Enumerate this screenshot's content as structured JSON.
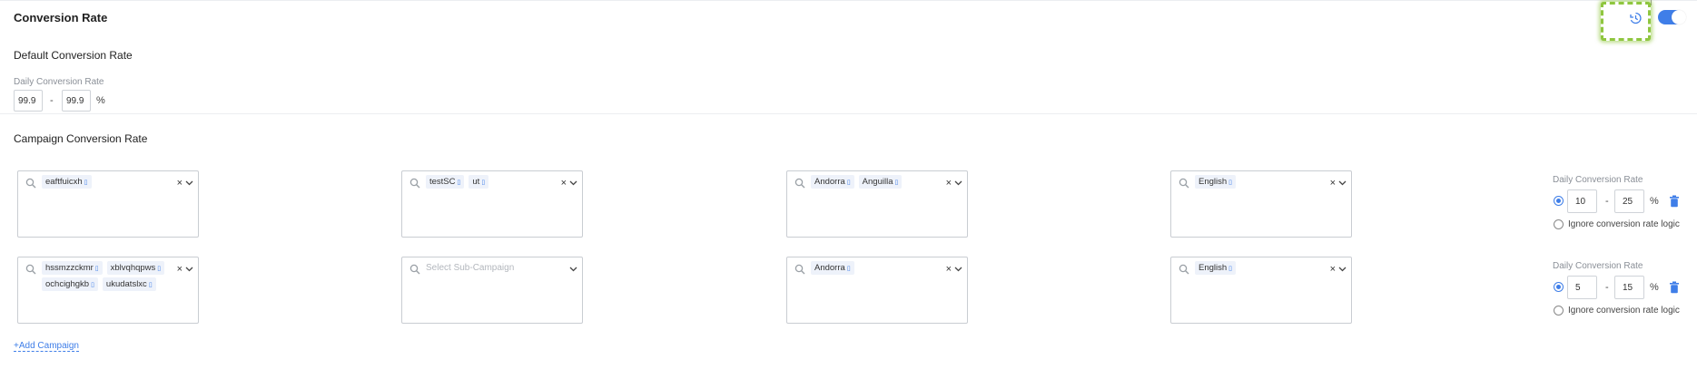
{
  "header": {
    "title": "Conversion Rate",
    "toggle_on": true
  },
  "default_rate": {
    "heading": "Default Conversion Rate",
    "field_label": "Daily Conversion Rate",
    "min_value": "99.9",
    "max_value": "99.9",
    "separator": "-",
    "unit": "%"
  },
  "campaign_section": {
    "heading": "Campaign Conversion Rate",
    "add_link": "+Add Campaign",
    "rows": [
      {
        "campaigns": [
          "eaftfuicxh"
        ],
        "sub_campaigns": [
          "testSC",
          "ut"
        ],
        "sub_campaign_placeholder": "",
        "countries": [
          "Andorra",
          "Anguilla"
        ],
        "languages": [
          "English"
        ],
        "rate_label": "Daily Conversion Rate",
        "min": "10",
        "max": "25",
        "separator": "-",
        "unit": "%",
        "ignore_label": "Ignore conversion rate logic",
        "range_selected": true
      },
      {
        "campaigns": [
          "hssmzzckmr",
          "xblvqhqpws",
          "ochcighgkb",
          "ukudatslxc"
        ],
        "sub_campaigns": [],
        "sub_campaign_placeholder": "Select Sub-Campaign",
        "countries": [
          "Andorra"
        ],
        "languages": [
          "English"
        ],
        "rate_label": "Daily Conversion Rate",
        "min": "5",
        "max": "15",
        "separator": "-",
        "unit": "%",
        "ignore_label": "Ignore conversion rate logic",
        "range_selected": true
      }
    ]
  },
  "colors": {
    "accent": "#3f7ee8",
    "highlight": "#8fc63f",
    "chip_bg": "#eef2fa"
  },
  "icons": {
    "history": "history-icon",
    "toggle": "toggle-switch",
    "search": "search-icon",
    "clear": "clear-icon",
    "chevron": "chevron-down-icon",
    "delete": "trash-icon",
    "chip_remove": "chip-remove-icon"
  }
}
